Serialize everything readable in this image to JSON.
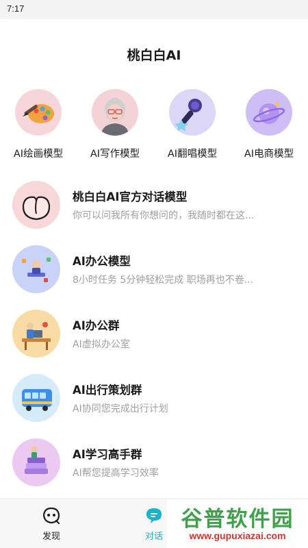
{
  "status_bar": {
    "time": "7:17"
  },
  "app": {
    "title": "桃白白AI"
  },
  "models": [
    {
      "label": "AI绘画模型",
      "icon": "paint-palette-icon",
      "bg": "#f6d6da"
    },
    {
      "label": "AI写作模型",
      "icon": "writer-avatar-icon",
      "bg": "#f4d3d6"
    },
    {
      "label": "AI翻唱模型",
      "icon": "microphone-icon",
      "bg": "#dcd7f6"
    },
    {
      "label": "AI电商模型",
      "icon": "shopping-planet-icon",
      "bg": "#cdbef6"
    }
  ],
  "chats": [
    {
      "name": "桃白白AI官方对话模型",
      "desc": "你可以问我所有你想问的，我随时都在这...",
      "icon": "peach-icon",
      "bg": "#f8d7d8"
    },
    {
      "name": "AI办公模型",
      "desc": "8小时任务 5分钟轻松完成 职场再也不卷...",
      "icon": "office-person-icon",
      "bg": "#c9d3f7"
    },
    {
      "name": "AI办公群",
      "desc": "AI虚拟办公室",
      "icon": "office-desk-icon",
      "bg": "#f9dba6"
    },
    {
      "name": "AI出行策划群",
      "desc": "AI协同您完成出行计划",
      "icon": "bus-icon",
      "bg": "#d6ecfa"
    },
    {
      "name": "AI学习高手群",
      "desc": "AI帮您提高学习效率",
      "icon": "study-books-icon",
      "bg": "#ecc9f0"
    }
  ],
  "tabs": [
    {
      "label": "发现",
      "icon": "discover-icon",
      "active": false
    },
    {
      "label": "对话",
      "icon": "chat-bubble-icon",
      "active": true
    }
  ],
  "watermark": {
    "main": "谷普软件园",
    "url": "www.gupuxiazai.com"
  },
  "colors": {
    "accent": "#18b4c9",
    "watermark_green": "#3fa14a",
    "watermark_red": "#d6322e"
  }
}
